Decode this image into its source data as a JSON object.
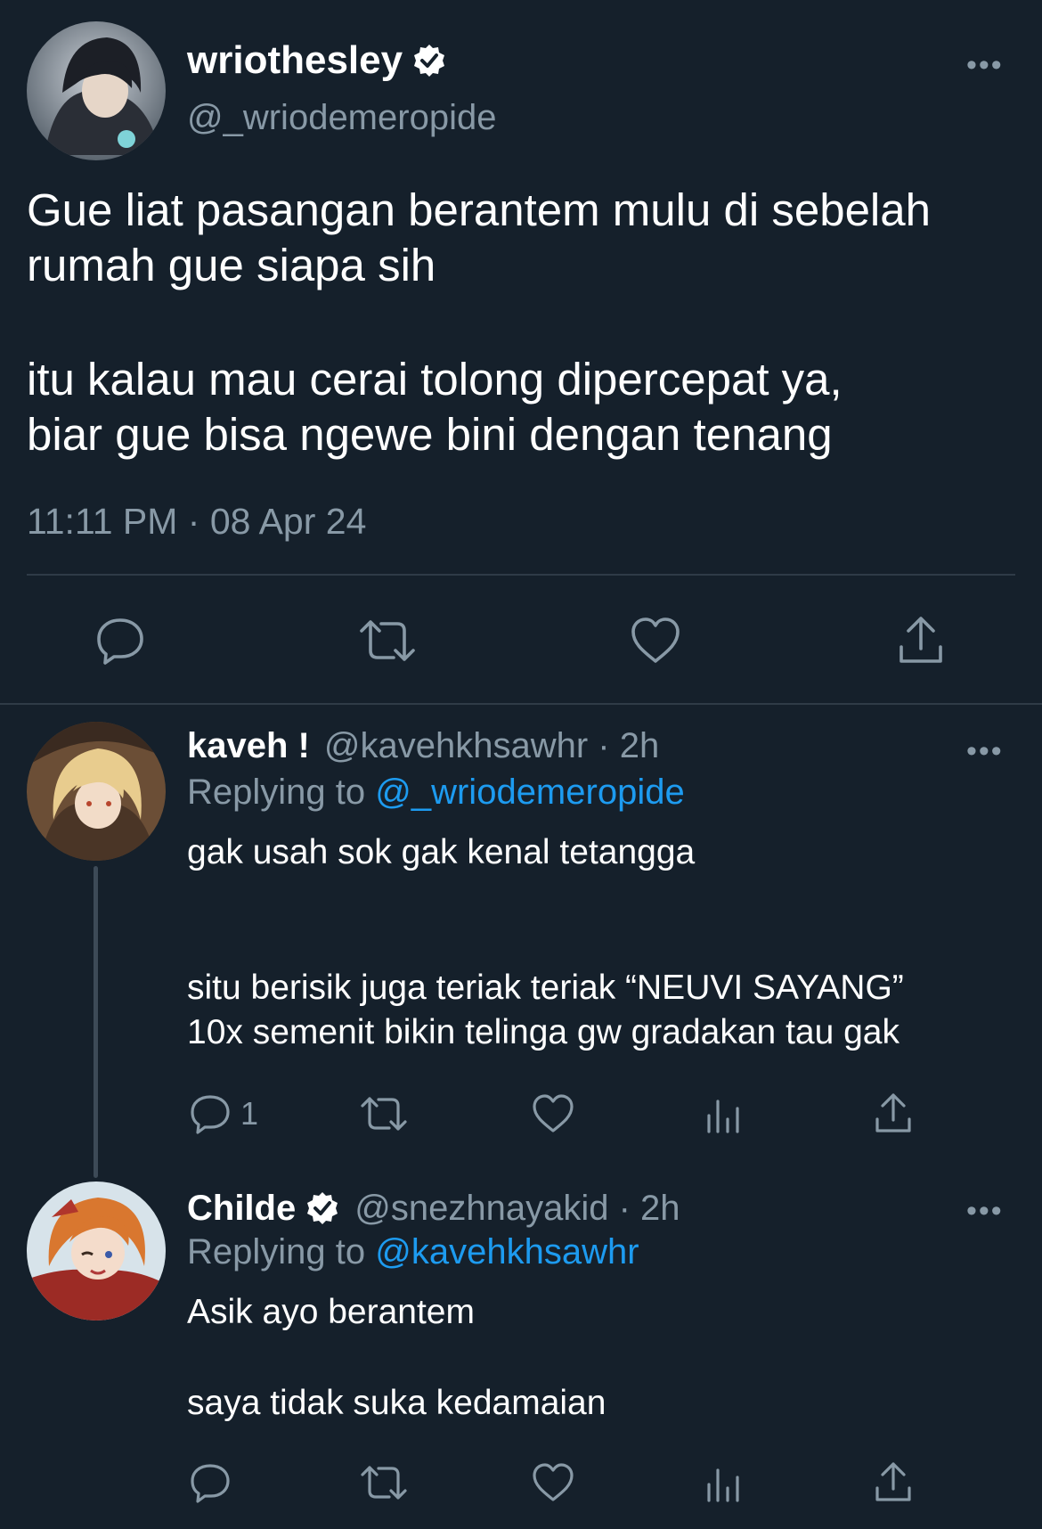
{
  "main_tweet": {
    "display_name": "wriothesley",
    "handle": "@_wriodemeropide",
    "text_line1": "Gue liat pasangan berantem mulu di sebelah",
    "text_line2": "rumah gue siapa sih",
    "text_line3": "itu kalau mau cerai tolong dipercepat ya,",
    "text_line4": "biar gue bisa ngewe bini dengan tenang",
    "timestamp": "11:11 PM · 08 Apr 24",
    "more_label": "•••"
  },
  "reply1": {
    "display_name": "kaveh !",
    "handle_time": "@kavehkhsawhr · 2h",
    "replying_prefix": "Replying to",
    "replying_to": "@_wriodemeropide",
    "text_line1": "gak usah sok gak kenal tetangga",
    "text_line2": "situ berisik juga teriak teriak “NEUVI SAYANG”",
    "text_line3": "10x semenit bikin telinga gw gradakan tau gak",
    "reply_count": "1",
    "more_label": "•••"
  },
  "reply2": {
    "display_name": "Childe",
    "handle_time": "@snezhnayakid · 2h",
    "replying_prefix": "Replying to",
    "replying_to": "@kavehkhsawhr",
    "text_line1": "Asik ayo berantem",
    "text_line2": "saya tidak suka kedamaian",
    "more_label": "•••"
  },
  "icons": {
    "reply": "speech-bubble-icon",
    "retweet": "retweet-icon",
    "like": "heart-icon",
    "views": "bar-chart-icon",
    "share": "share-icon",
    "verified": "verified-badge-icon"
  },
  "colors": {
    "background": "#15202b",
    "muted_text": "#8899a6",
    "link": "#1d9bf0",
    "divider": "#2f3b47"
  }
}
